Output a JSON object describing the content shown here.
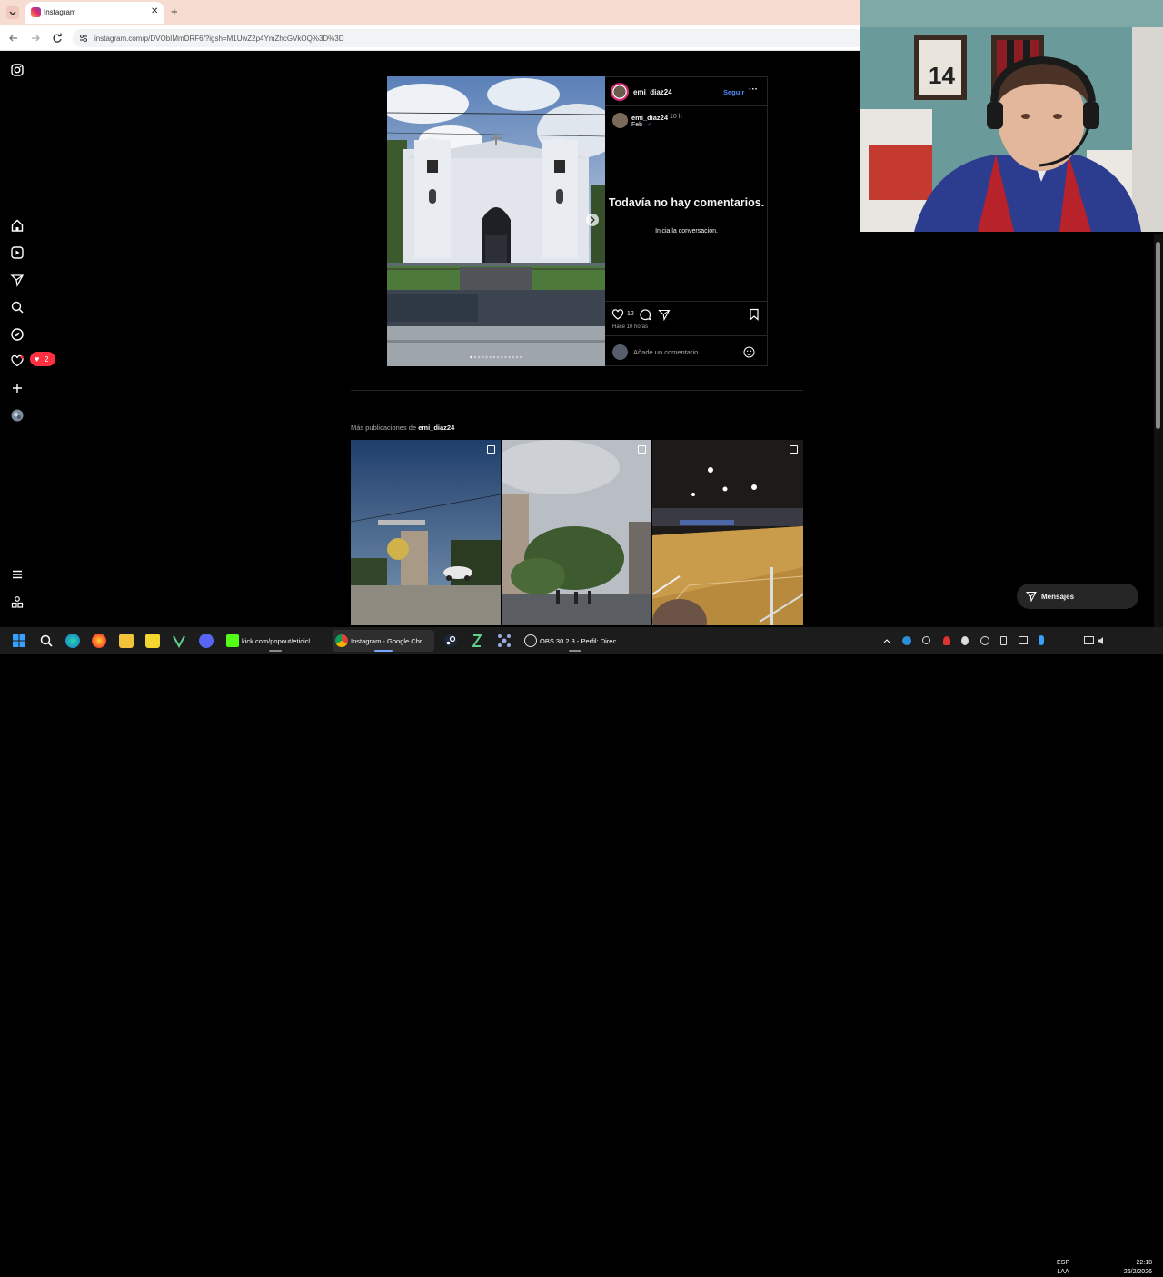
{
  "browser": {
    "tab_title": "Instagram",
    "url": "instagram.com/p/DVObIMmDRF6/?igsh=M1UwZ2p4YmZhcGVkOQ%3D%3D"
  },
  "sidebar": {
    "icons": [
      "instagram-icon",
      "home-icon",
      "reels-icon",
      "send-icon",
      "search-icon",
      "explore-icon",
      "heart-icon",
      "plus-icon",
      "profile-avatar",
      "menu-icon",
      "more-icon"
    ],
    "notification_count": "2"
  },
  "post": {
    "username": "emi_diaz24",
    "follow_label": "Seguir",
    "more_label": "···",
    "caption_username": "emi_diaz24",
    "caption_time": "10 h",
    "caption_text": "Feb",
    "caption_emoji": "♂",
    "no_comments_title": "Todavía no hay comentarios.",
    "no_comments_sub": "Inicia la conversación.",
    "likes": "12",
    "posted_ago": "Hace 10 horas",
    "comment_placeholder": "Añade un comentario...",
    "carousel_dots": 14,
    "carousel_active": 0
  },
  "more_posts": {
    "prefix": "Más publicaciones de",
    "username": "emi_diaz24"
  },
  "messages": {
    "label": "Mensajes"
  },
  "taskbar": {
    "apps": [
      {
        "label": "kick.com/popout/eticicl"
      },
      {
        "label": "Instagram - Google Chr"
      },
      {
        "label": "OBS 30.2.3 - Perfil: Direc"
      }
    ],
    "lang_line1": "ESP",
    "lang_line2": "LAA",
    "time": "22:18",
    "date": "26/2/2026"
  },
  "colors": {
    "accent_blue": "#4f8ef7",
    "notif_red": "#ff3040",
    "ig_background": "#000000"
  }
}
